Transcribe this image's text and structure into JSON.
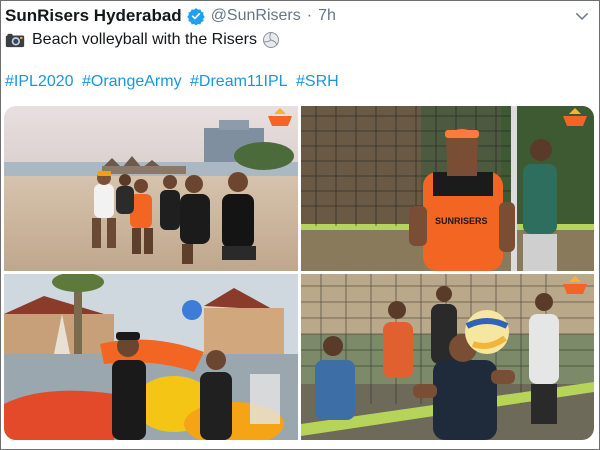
{
  "tweet": {
    "account_name": "SunRisers Hyderabad",
    "handle": "@SunRisers",
    "separator": "·",
    "time": "7h",
    "text": "Beach volleyball with the Risers",
    "hashtags": [
      "#IPL2020",
      "#OrangeArmy",
      "#Dream11IPL",
      "#SRH"
    ],
    "photo_jersey_text": "SUNRISERS"
  },
  "icons": {
    "verified": "verified-badge-icon",
    "caret": "chevron-down-icon",
    "camera": "camera-emoji-icon",
    "volleyball": "volleyball-emoji-icon"
  },
  "colors": {
    "brand_orange": "#f26522",
    "link_blue": "#1b95e0",
    "verified_blue": "#1da1f2",
    "muted_text": "#657786"
  }
}
